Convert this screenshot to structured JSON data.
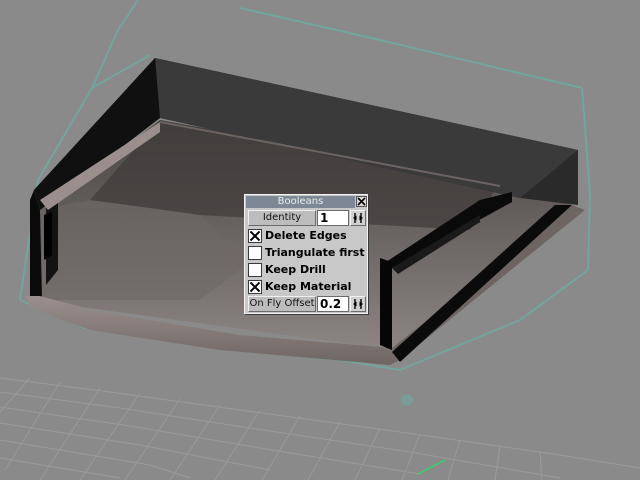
{
  "panel": {
    "title": "Booleans",
    "close_glyph": "✕",
    "identity": {
      "label": "Identity",
      "value": "1"
    },
    "options": [
      {
        "label": "Delete Edges",
        "checked": true
      },
      {
        "label": "Triangulate first",
        "checked": false
      },
      {
        "label": "Keep Drill",
        "checked": false
      },
      {
        "label": "Keep Material",
        "checked": true
      }
    ],
    "offset": {
      "label": "On Fly Offset",
      "value": "0.2"
    }
  },
  "icons": {
    "close": "close-icon",
    "spinner": "spinner-arrows-icon",
    "checkmark": "x-checkmark-icon"
  },
  "colors": {
    "viewport_bg": "#8a8a8a",
    "selection_cage": "#6fa8a0",
    "panel_bg": "#c8c8c8",
    "title_bar": "#7d8795"
  }
}
